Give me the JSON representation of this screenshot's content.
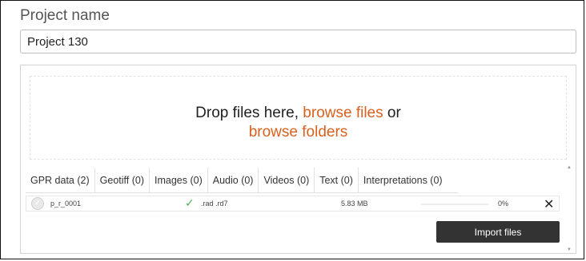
{
  "project": {
    "label": "Project name",
    "value": "Project 130"
  },
  "dropzone": {
    "text_before": "Drop files here, ",
    "browse_files": "browse files",
    "text_or": " or",
    "browse_folders": "browse folders"
  },
  "tabs": [
    {
      "label": "GPR data (2)"
    },
    {
      "label": "Geotiff (0)"
    },
    {
      "label": "Images (0)"
    },
    {
      "label": "Audio (0)"
    },
    {
      "label": "Videos (0)"
    },
    {
      "label": "Text (0)"
    },
    {
      "label": "Interpretations (0)"
    }
  ],
  "files": [
    {
      "name": "p_r_0001",
      "extensions": ".rad .rd7",
      "size": "5.83 MB",
      "progress_text": "0%",
      "progress": 0,
      "status_icon": "checkmark-icon",
      "remove_icon": "close-icon"
    }
  ],
  "actions": {
    "import_label": "Import files"
  },
  "colors": {
    "accent": "#d9611f",
    "button": "#333333",
    "ok": "#4caf50"
  }
}
